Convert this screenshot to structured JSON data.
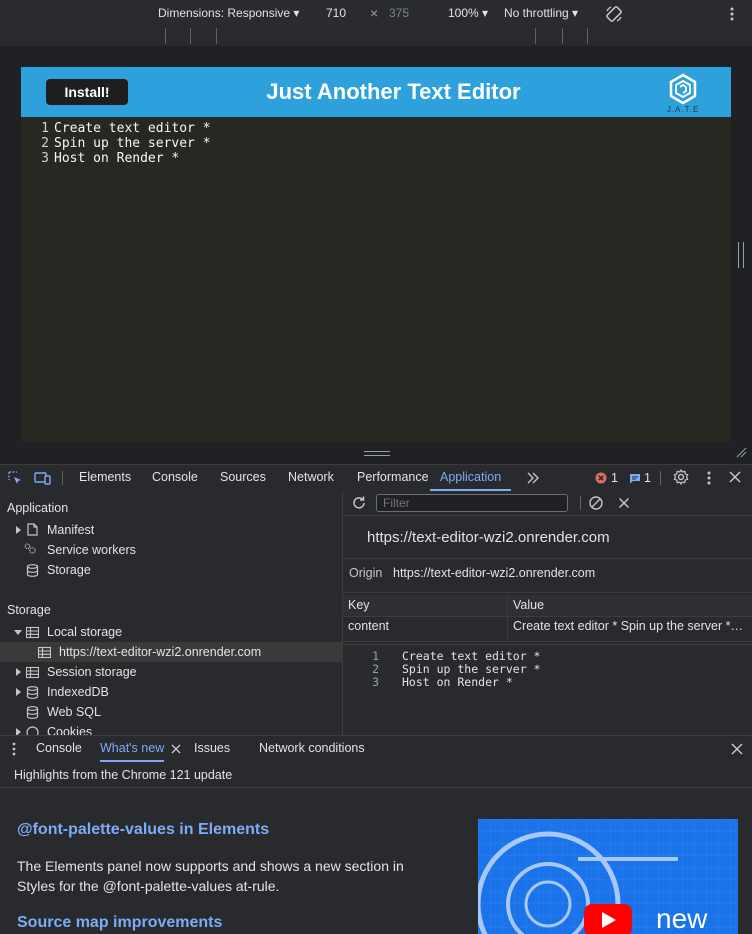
{
  "device_toolbar": {
    "dimensions_label": "Dimensions: Responsive ▾",
    "width": "710",
    "times": "×",
    "height": "375",
    "zoom": "100% ▾",
    "throttling": "No throttling ▾"
  },
  "app": {
    "install_label": "Install!",
    "title": "Just Another Text Editor",
    "logo_text": "J.A.T.E",
    "editor_lines": [
      {
        "num": "1",
        "text": "Create text editor *"
      },
      {
        "num": "2",
        "text": "Spin up the server *"
      },
      {
        "num": "3",
        "text": "Host on Render *"
      }
    ]
  },
  "devtools": {
    "tabs": [
      "Elements",
      "Console",
      "Sources",
      "Network",
      "Performance",
      "Application"
    ],
    "active_tab": "Application",
    "error_count": "1",
    "message_count": "1"
  },
  "sidebar": {
    "application_header": "Application",
    "application_items": [
      "Manifest",
      "Service workers",
      "Storage"
    ],
    "storage_header": "Storage",
    "storage_items": {
      "local_storage": "Local storage",
      "local_origin": "https://text-editor-wzi2.onrender.com",
      "session_storage": "Session storage",
      "indexeddb": "IndexedDB",
      "websql": "Web SQL",
      "cookies": "Cookies"
    }
  },
  "storage_view": {
    "filter_placeholder": "Filter",
    "origin_title": "https://text-editor-wzi2.onrender.com",
    "origin_label": "Origin",
    "origin_value": "https://text-editor-wzi2.onrender.com",
    "columns": {
      "key": "Key",
      "value": "Value"
    },
    "rows": [
      {
        "key": "content",
        "value": "Create text editor * Spin up the server *…"
      }
    ],
    "preview_lines": [
      {
        "num": "1",
        "text": "Create text editor *"
      },
      {
        "num": "2",
        "text": "Spin up the server *"
      },
      {
        "num": "3",
        "text": "Host on Render *"
      }
    ]
  },
  "drawer": {
    "tabs": [
      "Console",
      "What's new",
      "Issues",
      "Network conditions"
    ],
    "active_tab": "What's new",
    "highlights": "Highlights from the Chrome 121 update",
    "feature1_title": "@font-palette-values in Elements",
    "feature1_desc": "The Elements panel now supports and shows a new section in Styles for the @font-palette-values at-rule.",
    "feature2_title": "Source map improvements",
    "video_label": "new"
  },
  "colors": {
    "accent": "#7cacf8",
    "app_header": "#2ea1dc",
    "editor_bg": "#272822",
    "error": "#e46962"
  }
}
